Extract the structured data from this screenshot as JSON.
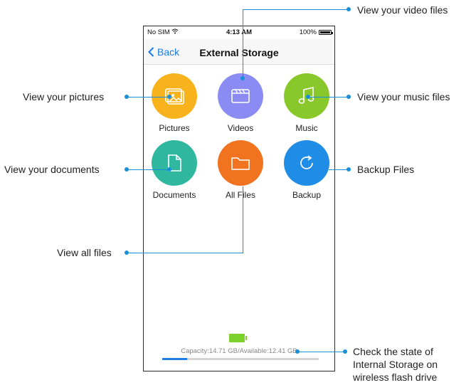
{
  "status_bar": {
    "carrier": "No SIM",
    "time": "4:13 AM",
    "battery": "100%"
  },
  "nav": {
    "back_label": "Back",
    "title": "External Storage"
  },
  "tiles": [
    {
      "label": "Pictures",
      "color": "#f8b21b",
      "icon": "pictures-icon"
    },
    {
      "label": "Videos",
      "color": "#8b8cf3",
      "icon": "videos-icon"
    },
    {
      "label": "Music",
      "color": "#89c82a",
      "icon": "music-icon"
    },
    {
      "label": "Documents",
      "color": "#2fb7a0",
      "icon": "document-icon"
    },
    {
      "label": "All Files",
      "color": "#f2731f",
      "icon": "folder-icon"
    },
    {
      "label": "Backup",
      "color": "#1f8ce6",
      "icon": "refresh-icon"
    }
  ],
  "storage": {
    "capacity_text": "Capacity:14.71 GB/Available:12.41 GB",
    "used_fraction": 0.16,
    "battery_color": "#7bd12a"
  },
  "annotations": {
    "video": "View your video files",
    "pictures": "View your pictures",
    "music": "View your music files",
    "documents": "View your documents",
    "backup": "Backup Files",
    "all_files": "View all files",
    "storage_line1": "Check the state of",
    "storage_line2": "Internal Storage on",
    "storage_line3": "wireless flash drive"
  },
  "accent_color": "#1a8fd8"
}
